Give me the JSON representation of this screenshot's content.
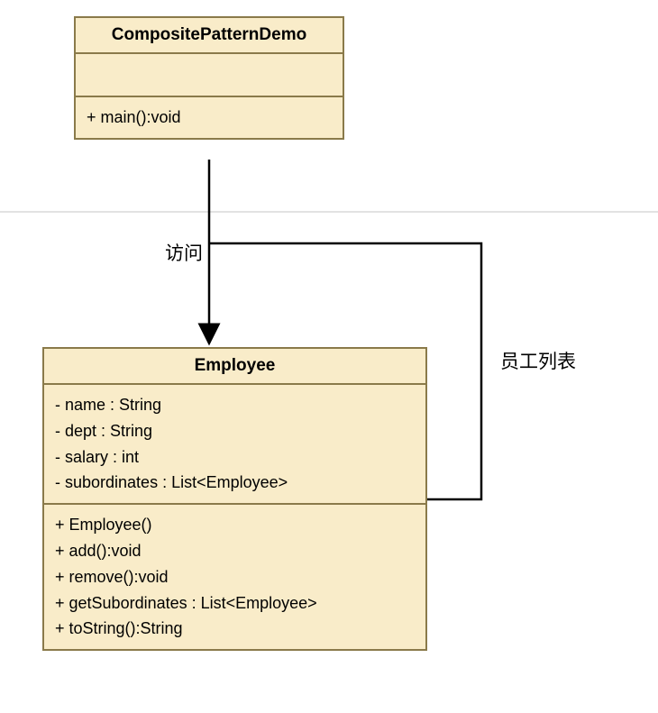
{
  "class1": {
    "name": "CompositePatternDemo",
    "attrs": [],
    "methods": [
      "+ main():void"
    ]
  },
  "class2": {
    "name": "Employee",
    "attrs": [
      "- name : String",
      "- dept : String",
      "- salary : int",
      "- subordinates : List<Employee>"
    ],
    "methods": [
      "+ Employee()",
      "+ add():void",
      "+ remove():void",
      "+ getSubordinates : List<Employee>",
      "+ toString():String"
    ]
  },
  "labels": {
    "access": "访问",
    "list": "员工列表"
  },
  "colors": {
    "classFill": "#f9ecc9",
    "classBorder": "#8a7a4a",
    "divider": "#e2e2e2"
  }
}
